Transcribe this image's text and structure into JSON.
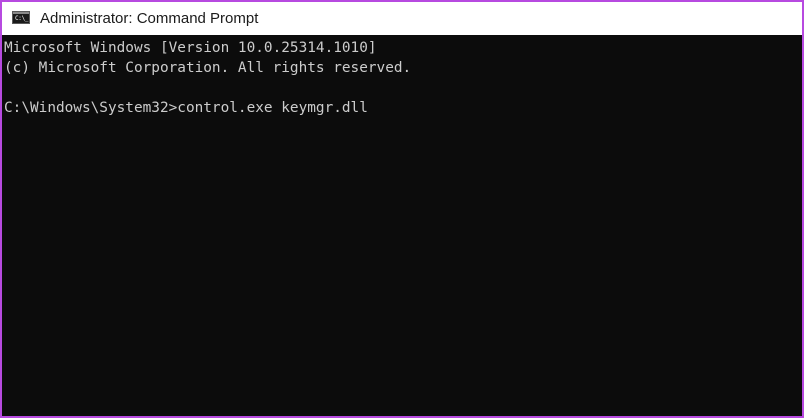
{
  "window": {
    "title": "Administrator: Command Prompt",
    "icon_name": "command-prompt-icon",
    "icon_text": "C:\\_",
    "border_color": "#b74ae0"
  },
  "console": {
    "background": "#0c0c0c",
    "text_color": "#cccccc",
    "lines": [
      "Microsoft Windows [Version 10.0.25314.1010]",
      "(c) Microsoft Corporation. All rights reserved.",
      "",
      "C:\\Windows\\System32>control.exe keymgr.dll"
    ]
  }
}
